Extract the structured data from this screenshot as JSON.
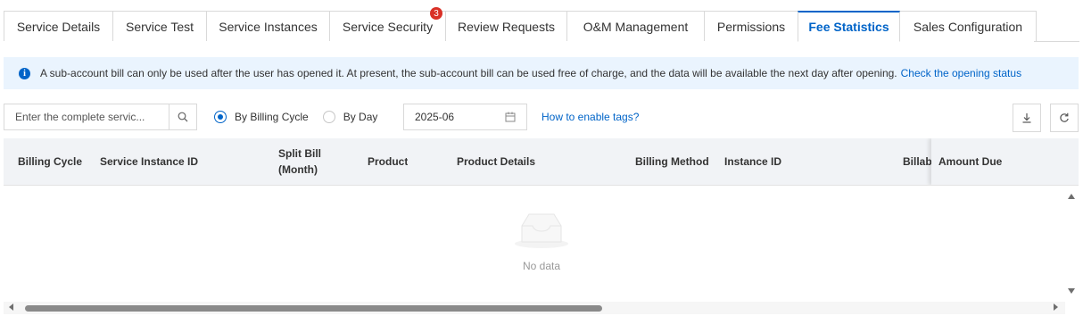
{
  "tabs": [
    {
      "label": "Service Details",
      "active": false
    },
    {
      "label": "Service Test",
      "active": false
    },
    {
      "label": "Service Instances",
      "active": false
    },
    {
      "label": "Service Security",
      "active": false,
      "badge": "3"
    },
    {
      "label": "Review Requests",
      "active": false
    },
    {
      "label": "O&M Management",
      "active": false
    },
    {
      "label": "Permissions",
      "active": false
    },
    {
      "label": "Fee Statistics",
      "active": true
    },
    {
      "label": "Sales Configuration",
      "active": false
    }
  ],
  "notice": {
    "icon": "info-icon",
    "text": "A sub-account bill can only be used after the user has opened it. At present, the sub-account bill can be used free of charge, and the data will be available the next day after opening.",
    "link": "Check the opening status"
  },
  "toolbar": {
    "search_placeholder": "Enter the complete servic...",
    "search_icon": "search-icon",
    "radio_billing_cycle": "By Billing Cycle",
    "radio_by_day": "By Day",
    "selected_radio": "By Billing Cycle",
    "date_value": "2025-06",
    "date_icon": "calendar-icon",
    "tags_link": "How to enable tags?",
    "download_icon": "download-icon",
    "refresh_icon": "refresh-icon"
  },
  "table": {
    "columns": [
      {
        "label": "Billing Cycle"
      },
      {
        "label": "Service Instance ID"
      },
      {
        "label": "Split Bill (Month)",
        "line1": "Split Bill",
        "line2": "(Month)"
      },
      {
        "label": "Product"
      },
      {
        "label": "Product Details"
      },
      {
        "label": "Billing Method"
      },
      {
        "label": "Instance ID"
      },
      {
        "label": "Billable"
      },
      {
        "label": "Amount Due"
      }
    ],
    "rows": [],
    "empty_text": "No data"
  },
  "colors": {
    "accent": "#0064c8",
    "badge": "#d93026",
    "notice_bg": "#eaf4fe",
    "header_bg": "#f1f3f6"
  }
}
